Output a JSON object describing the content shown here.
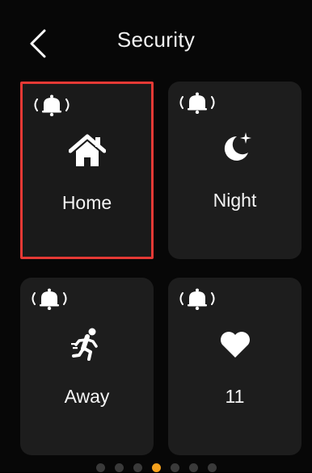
{
  "header": {
    "title": "Security",
    "back_icon": "chevron-left-icon"
  },
  "tiles": [
    {
      "label": "Home",
      "icon": "house-icon",
      "alarm_icon": "alarm-bell-icon",
      "selected": true
    },
    {
      "label": "Night",
      "icon": "moon-star-icon",
      "alarm_icon": "alarm-bell-icon",
      "selected": false
    },
    {
      "label": "Away",
      "icon": "running-man-icon",
      "alarm_icon": "alarm-bell-icon",
      "selected": false
    },
    {
      "label": "11",
      "icon": "heart-icon",
      "alarm_icon": "alarm-bell-icon",
      "selected": false
    }
  ],
  "pager": {
    "count": 7,
    "active_index": 3
  },
  "colors": {
    "selection_border": "#e53935",
    "pager_active": "#f4a11d",
    "tile_background": "#1d1d1d"
  }
}
